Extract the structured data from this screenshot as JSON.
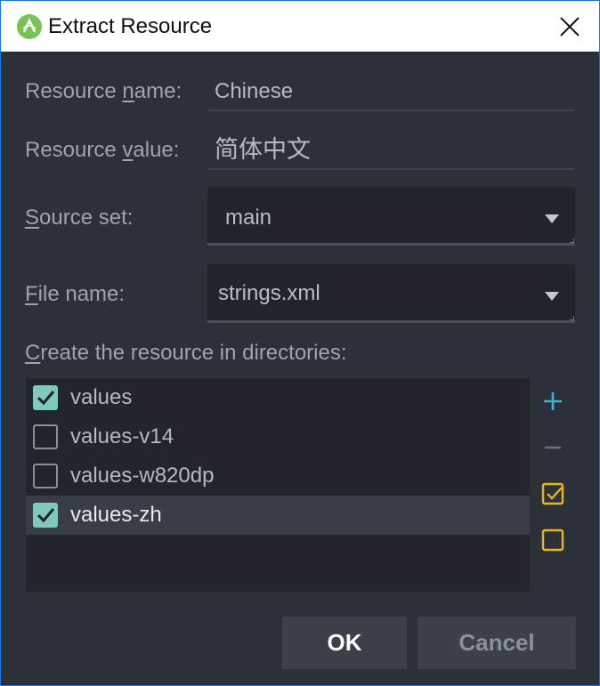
{
  "window": {
    "title": "Extract Resource",
    "app_icon": "android-studio-icon",
    "close_icon": "close-icon"
  },
  "form": {
    "resource_name": {
      "label_pre": "Resource ",
      "label_key": "n",
      "label_post": "ame:",
      "value": "Chinese"
    },
    "resource_value": {
      "label_pre": "Resource ",
      "label_key": "v",
      "label_post": "alue:",
      "value": "简体中文"
    },
    "source_set": {
      "label_pre": "",
      "label_key": "S",
      "label_post": "ource set:",
      "value": "main"
    },
    "file_name": {
      "label_pre": "",
      "label_key": "F",
      "label_post": "ile name:",
      "value": "strings.xml"
    }
  },
  "directories": {
    "label_pre": "",
    "label_key": "C",
    "label_post": "reate the resource in directories:",
    "items": [
      {
        "name": "values",
        "checked": true,
        "selected": false
      },
      {
        "name": "values-v14",
        "checked": false,
        "selected": false
      },
      {
        "name": "values-w820dp",
        "checked": false,
        "selected": false
      },
      {
        "name": "values-zh",
        "checked": true,
        "selected": true
      }
    ]
  },
  "side_tools": [
    "add-icon",
    "remove-icon",
    "select-all-icon",
    "unselect-all-icon"
  ],
  "buttons": {
    "ok": "OK",
    "cancel": "Cancel"
  },
  "colors": {
    "accent_add": "#3fb0d9",
    "accent_check": "#e8b417",
    "checkbox_fill": "#7ec8bc"
  }
}
